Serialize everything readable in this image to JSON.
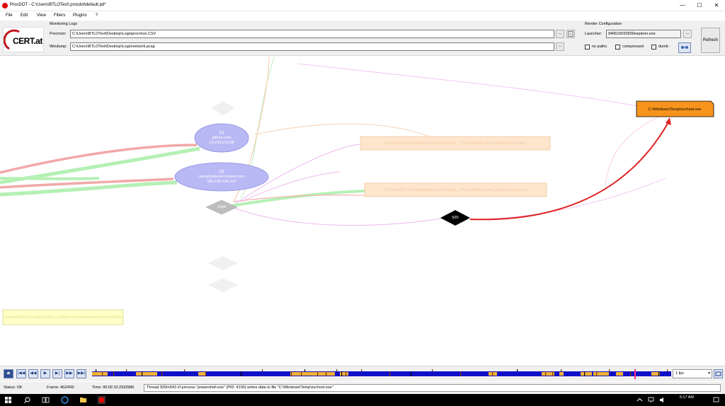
{
  "window": {
    "title": "ProcDOT - C:\\Users\\BTLOTest\\.procdot\\default.pd*",
    "controls": {
      "minimize": "—",
      "maximize": "☐",
      "close": "✕"
    }
  },
  "menu": [
    "File",
    "Edit",
    "View",
    "Filters",
    "Plugins",
    "?"
  ],
  "logo": {
    "text": "CERT.at"
  },
  "monitoring": {
    "title": "Monitoring Logs",
    "procmon_label": "Procmon:",
    "procmon_value": "C:\\Users\\BTLOTest\\Desktop\\Logs\\procmon.CSV",
    "windump_label": "Windump:",
    "windump_value": "C:\\Users\\BTLOTest\\Desktop\\Logs\\network.pcap",
    "browse_label": "..."
  },
  "render": {
    "title": "Render Configuration",
    "launcher_label": "Launcher:",
    "launcher_value": "940610033900explorer.exe",
    "browse_label": "...",
    "options": [
      {
        "label": "no paths",
        "checked": false
      },
      {
        "label": "compressed",
        "checked": false
      },
      {
        "label": "dumb",
        "checked": false
      }
    ],
    "refresh_label": "Refresh"
  },
  "graph": {
    "nodes": {
      "github": {
        "line1": "[2]",
        "line2": "github.com",
        "line3": "13.234.210.38"
      },
      "rawgh": {
        "line1": "[3]",
        "line2": "raw.githubusercontent.com",
        "line3": "185.199.108.133"
      },
      "proc1984": "1984",
      "proc920": "920",
      "svchost": "C:\\Windows\\Temp\\svchost.exe",
      "file1": "C:\\Users\\BTLOTest\\AppData\\Local\\Temp\\__PSScriptPolicyTest_fmktgacw.wxp.ps1",
      "file2": "C:\\Users\\BTLOTest\\AppData\\Local\\Temp\\__PSScriptPolicyTest_xyf2bi5b.sqz.psm1",
      "file3": "<Users\\BTLOTest\\AppData\\Local\\Microsoft\\Windows\\PowerShell\\StartupProfileData-NonInteractive"
    },
    "colors": {
      "svchost_fill": "#f7941d",
      "network_fill": "#b9b9f5",
      "file_faded": "#fde6cc",
      "highlight_edge": "#e02020"
    }
  },
  "playbar": {
    "buttons": [
      "⏏",
      "|◀◀",
      "◀◀",
      "▶",
      "▶|",
      "▶▶",
      "▶▶|"
    ],
    "fps": "1 fps",
    "fps_arrow": "▾"
  },
  "status": {
    "status_text": "Status:  OK",
    "frame_text": "Frame:   462/492",
    "time_text": "Time:   00:02:10.2932986",
    "message": "Thread 920m543 of process \"powershell.exe\" (PID: 4100) writes data to file \"C:\\Windows\\Temp\\svchost.exe\""
  },
  "taskbar": {
    "time": "5:17 AM"
  }
}
